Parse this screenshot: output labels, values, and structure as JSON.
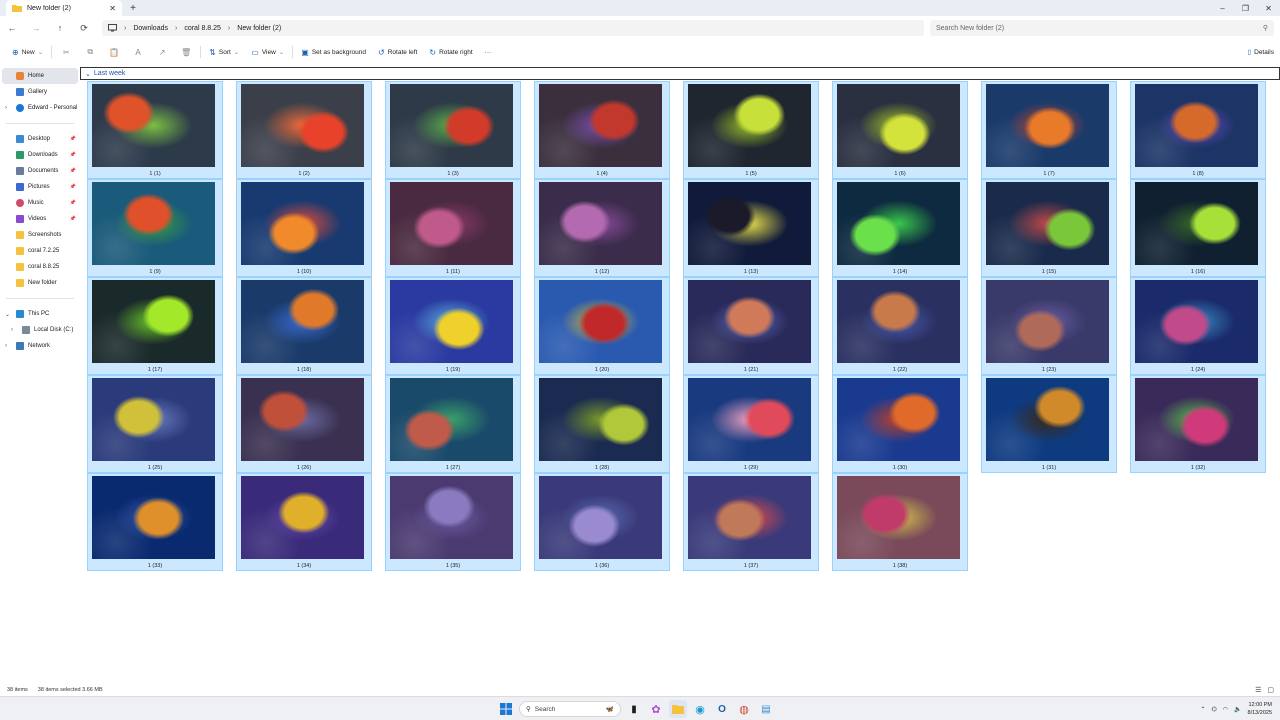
{
  "window": {
    "tab_title": "New folder (2)",
    "new_tab": "+",
    "controls": [
      "–",
      "❐",
      "✕"
    ]
  },
  "nav": {
    "back": "←",
    "forward": "→",
    "up": "↑",
    "refresh": "⟳",
    "breadcrumbs": [
      "Downloads",
      "coral 8.8.25",
      "New folder (2)"
    ],
    "search_placeholder": "Search New folder (2)"
  },
  "commands": {
    "new": "New",
    "sort": "Sort",
    "view": "View",
    "set_background": "Set as background",
    "rotate_left": "Rotate left",
    "rotate_right": "Rotate right",
    "more": "···",
    "details": "Details"
  },
  "sidebar": {
    "top": [
      {
        "label": "Home",
        "icon": "home-icon"
      },
      {
        "label": "Gallery",
        "icon": "gallery-icon"
      },
      {
        "label": "Edward - Personal",
        "icon": "cloud-icon"
      }
    ],
    "pinned": [
      {
        "label": "Desktop",
        "icon": "desktop-icon"
      },
      {
        "label": "Downloads",
        "icon": "download-icon"
      },
      {
        "label": "Documents",
        "icon": "documents-icon"
      },
      {
        "label": "Pictures",
        "icon": "pictures-icon"
      },
      {
        "label": "Music",
        "icon": "music-icon"
      },
      {
        "label": "Videos",
        "icon": "videos-icon"
      },
      {
        "label": "Screenshots",
        "icon": "folder-icon"
      },
      {
        "label": "coral 7.2.25",
        "icon": "folder-icon"
      },
      {
        "label": "coral 8.8.25",
        "icon": "folder-icon"
      },
      {
        "label": "New folder",
        "icon": "folder-icon"
      }
    ],
    "bottom": [
      {
        "label": "This PC",
        "icon": "pc-icon"
      },
      {
        "label": "Local Disk (C:)",
        "icon": "disk-icon"
      },
      {
        "label": "Network",
        "icon": "network-icon"
      }
    ]
  },
  "group": {
    "label": "Last week"
  },
  "files": [
    {
      "name": "1 (1)",
      "base": "#2d3a4a",
      "accent": "#e0522a",
      "accent2": "#7bc043"
    },
    {
      "name": "1 (2)",
      "base": "#3a3f4a",
      "accent": "#e8432a",
      "accent2": "#f06a3a"
    },
    {
      "name": "1 (3)",
      "base": "#2e3a48",
      "accent": "#d23a2a",
      "accent2": "#5ab04a"
    },
    {
      "name": "1 (4)",
      "base": "#3b2f3e",
      "accent": "#c2382c",
      "accent2": "#7b4fb0"
    },
    {
      "name": "1 (5)",
      "base": "#1f2630",
      "accent": "#c8e03a",
      "accent2": "#9ac02a"
    },
    {
      "name": "1 (6)",
      "base": "#2a3040",
      "accent": "#d4e23c",
      "accent2": "#a8c826"
    },
    {
      "name": "1 (7)",
      "base": "#1a3a6a",
      "accent": "#e87a2a",
      "accent2": "#d0452a"
    },
    {
      "name": "1 (8)",
      "base": "#1c3466",
      "accent": "#d66a2a",
      "accent2": "#6a4cc2"
    },
    {
      "name": "1 (9)",
      "base": "#1a5a7a",
      "accent": "#e0502a",
      "accent2": "#3aa040"
    },
    {
      "name": "1 (10)",
      "base": "#183a70",
      "accent": "#f08a2a",
      "accent2": "#e04a3a"
    },
    {
      "name": "1 (11)",
      "base": "#4a2a40",
      "accent": "#c05a8a",
      "accent2": "#8a3a6a"
    },
    {
      "name": "1 (12)",
      "base": "#3a2c4a",
      "accent": "#b46ab0",
      "accent2": "#8a4a9a"
    },
    {
      "name": "1 (13)",
      "base": "#101a3a",
      "accent": "#1a1a2a",
      "accent2": "#e8e04a"
    },
    {
      "name": "1 (14)",
      "base": "#0e2a40",
      "accent": "#6ae04a",
      "accent2": "#3ac84a"
    },
    {
      "name": "1 (15)",
      "base": "#1a2a4a",
      "accent": "#7ac83a",
      "accent2": "#c04a4a"
    },
    {
      "name": "1 (16)",
      "base": "#102030",
      "accent": "#a8e03a",
      "accent2": "#3a6a2a"
    },
    {
      "name": "1 (17)",
      "base": "#1a2a2a",
      "accent": "#a4e82a",
      "accent2": "#6ac82a"
    },
    {
      "name": "1 (18)",
      "base": "#1a3a6a",
      "accent": "#e07a2a",
      "accent2": "#3a6ad0"
    },
    {
      "name": "1 (19)",
      "base": "#2a3aa0",
      "accent": "#f0d02a",
      "accent2": "#5ab0e0"
    },
    {
      "name": "1 (20)",
      "base": "#2a5ab0",
      "accent": "#c0282a",
      "accent2": "#e0c02a"
    },
    {
      "name": "1 (21)",
      "base": "#2a2a5a",
      "accent": "#d07a5a",
      "accent2": "#5a6ac0"
    },
    {
      "name": "1 (22)",
      "base": "#2a3060",
      "accent": "#c87a4a",
      "accent2": "#4a5ab0"
    },
    {
      "name": "1 (23)",
      "base": "#3a3a6a",
      "accent": "#b06a5a",
      "accent2": "#6a5aa0"
    },
    {
      "name": "1 (24)",
      "base": "#1a2a6a",
      "accent": "#c04a8a",
      "accent2": "#3a8ac0"
    },
    {
      "name": "1 (25)",
      "base": "#2a3a7a",
      "accent": "#d0c03a",
      "accent2": "#6a7ac0"
    },
    {
      "name": "1 (26)",
      "base": "#3a3050",
      "accent": "#c0503a",
      "accent2": "#6a6aa0"
    },
    {
      "name": "1 (27)",
      "base": "#1a4a6a",
      "accent": "#c05a4a",
      "accent2": "#3aa06a"
    },
    {
      "name": "1 (28)",
      "base": "#1a2a50",
      "accent": "#b0c83a",
      "accent2": "#7a9a2a"
    },
    {
      "name": "1 (29)",
      "base": "#1a3a80",
      "accent": "#e04a5a",
      "accent2": "#f0a0c0"
    },
    {
      "name": "1 (30)",
      "base": "#1a3a90",
      "accent": "#e06a2a",
      "accent2": "#c0402a"
    },
    {
      "name": "1 (31)",
      "base": "#0e3a80",
      "accent": "#d08a2a",
      "accent2": "#3a2a1a"
    },
    {
      "name": "1 (32)",
      "base": "#3a2a5a",
      "accent": "#d03a7a",
      "accent2": "#5ac04a"
    },
    {
      "name": "1 (33)",
      "base": "#0a2a70",
      "accent": "#e0902a",
      "accent2": "#3a5ab0"
    },
    {
      "name": "1 (34)",
      "base": "#3a2a7a",
      "accent": "#e0b02a",
      "accent2": "#6a4ab0"
    },
    {
      "name": "1 (35)",
      "base": "#4a3a70",
      "accent": "#8a7ac0",
      "accent2": "#6a5aa0"
    },
    {
      "name": "1 (36)",
      "base": "#3a3a7a",
      "accent": "#9a8ad0",
      "accent2": "#5a6ab0"
    },
    {
      "name": "1 (37)",
      "base": "#3a3a7a",
      "accent": "#c07a5a",
      "accent2": "#e04a4a"
    },
    {
      "name": "1 (38)",
      "base": "#7a4a5a",
      "accent": "#c03a6a",
      "accent2": "#d0c04a"
    }
  ],
  "status": {
    "items": "38 items",
    "selected": "38 items selected  3.66 MB"
  },
  "taskbar": {
    "search": "Search",
    "time": "12:00 PM",
    "date": "8/13/2025"
  }
}
